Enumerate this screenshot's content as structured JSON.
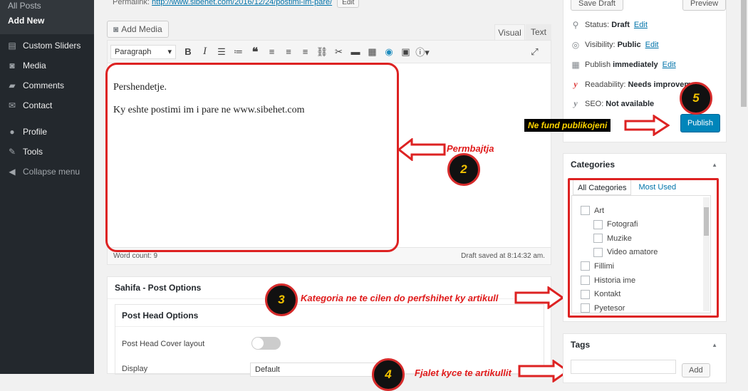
{
  "sidebar": {
    "submenu": [
      {
        "label": "All Posts"
      },
      {
        "label": "Add New"
      }
    ],
    "items": [
      {
        "label": "Custom Sliders",
        "icon": "slides-icon"
      },
      {
        "label": "Media",
        "icon": "media-icon"
      },
      {
        "label": "Comments",
        "icon": "comment-icon"
      },
      {
        "label": "Contact",
        "icon": "envelope-icon"
      },
      {
        "label": "Profile",
        "icon": "user-icon"
      },
      {
        "label": "Tools",
        "icon": "wrench-icon"
      },
      {
        "label": "Collapse menu",
        "icon": "collapse-icon"
      }
    ]
  },
  "permalink": {
    "label": "Permalink:",
    "url": "http://www.sibehet.com/2016/12/24/postimi-im-pare/",
    "edit_label": "Edit"
  },
  "editor": {
    "add_media_label": "Add Media",
    "tab_visual": "Visual",
    "tab_text": "Text",
    "format_select": "Paragraph",
    "paragraphs": [
      "Pershendetje.",
      "Ky eshte postimi im i pare ne www.sibehet.com"
    ],
    "word_count": "Word count: 9",
    "draft_saved": "Draft saved at 8:14:32 am."
  },
  "sahifa": {
    "title": "Sahifa - Post Options",
    "section_title": "Post Head Options",
    "cover_layout_label": "Post Head Cover layout",
    "display_label": "Display",
    "display_value": "Default"
  },
  "publish": {
    "save_draft": "Save Draft",
    "preview": "Preview",
    "status_label": "Status:",
    "status_value": "Draft",
    "visibility_label": "Visibility:",
    "visibility_value": "Public",
    "publish_label": "Publish",
    "publish_value": "immediately",
    "readability_label": "Readability:",
    "readability_value": "Needs improveme",
    "seo_label": "SEO:",
    "seo_value": "Not available",
    "edit_link": "Edit",
    "publish_button": "Publish"
  },
  "categories": {
    "title": "Categories",
    "tab_all": "All Categories",
    "tab_most_used": "Most Used",
    "items": [
      {
        "label": "Art",
        "level": 0
      },
      {
        "label": "Fotografi",
        "level": 1
      },
      {
        "label": "Muzike",
        "level": 1
      },
      {
        "label": "Video amatore",
        "level": 1
      },
      {
        "label": "Fillimi",
        "level": 0
      },
      {
        "label": "Historia ime",
        "level": 0
      },
      {
        "label": "Kontakt",
        "level": 0
      },
      {
        "label": "Pyetesor",
        "level": 0
      }
    ]
  },
  "tags": {
    "title": "Tags",
    "add_button": "Add"
  },
  "annotations": {
    "permbajtja": "Permbajtja",
    "kategoria": "Kategoria ne te cilen do perfshihet ky artikull",
    "ne_fund": "Ne fund publikojeni",
    "fjalet": "Fjalet kyce te artikullit",
    "badge2": "2",
    "badge3": "3",
    "badge4": "4",
    "badge5": "5"
  },
  "colors": {
    "sidebar_bg": "#23282d",
    "accent_blue": "#0085ba",
    "annotation_red": "#e01b1b",
    "badge_yellow": "#f2c200"
  }
}
